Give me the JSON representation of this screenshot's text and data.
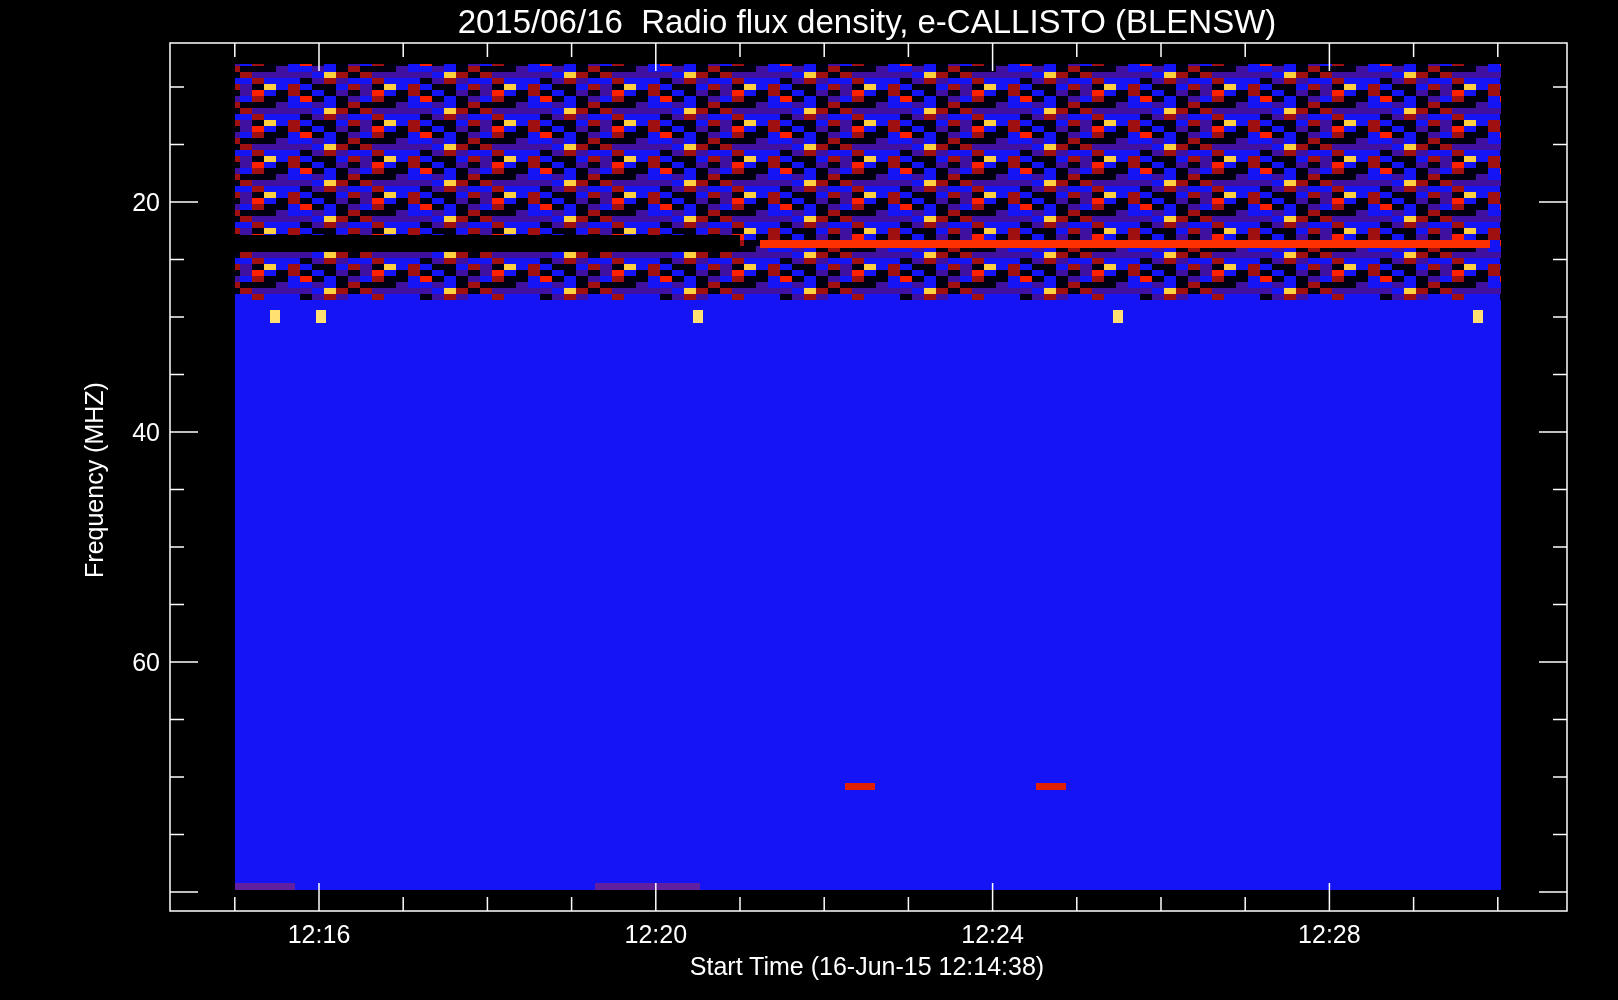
{
  "title": "2015/06/16  Radio flux density, e-CALLISTO (BLENSW)",
  "x_axis": {
    "label": "Start Time (16-Jun-15 12:14:38)",
    "ticks": [
      "12:16",
      "12:20",
      "12:24",
      "12:28"
    ]
  },
  "y_axis": {
    "label": "Frequency (MHZ)",
    "ticks": [
      "20",
      "40",
      "60"
    ]
  }
}
